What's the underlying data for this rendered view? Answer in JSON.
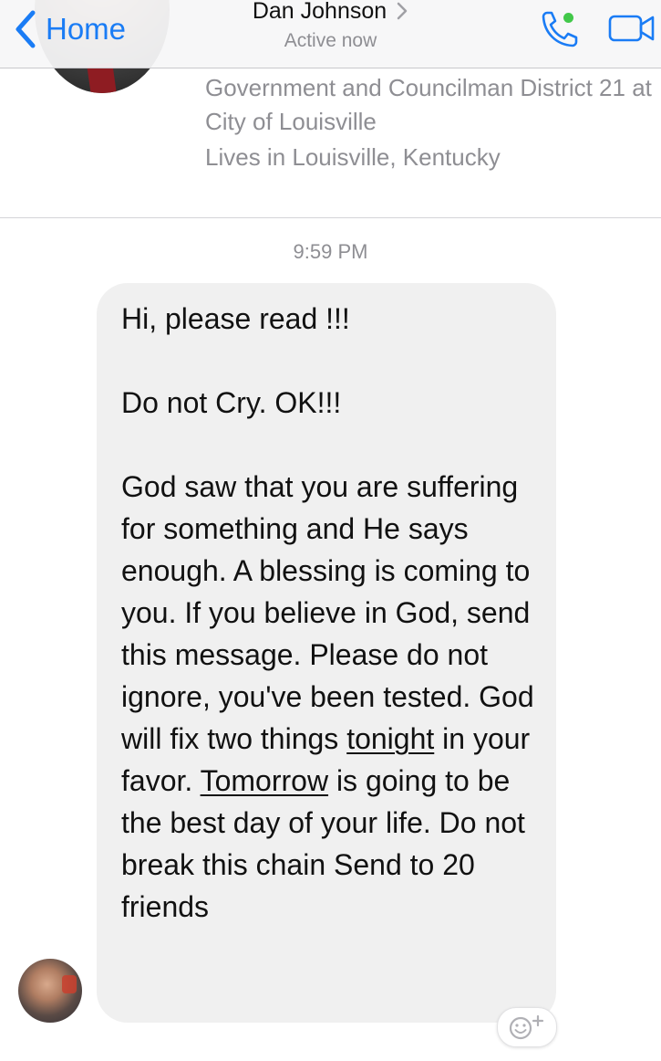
{
  "nav": {
    "back_label": "Home",
    "title": "Dan Johnson",
    "status": "Active now"
  },
  "profile": {
    "work": "Government and Councilman District 21 at City of Louisville",
    "lives": "Lives in Louisville, Kentucky"
  },
  "conversation": {
    "timestamp": "9:59 PM",
    "message": {
      "line1": "Hi, please read !!!",
      "line2": " Do not Cry. OK!!!",
      "p3_before_tonight": " God saw that you are suffering for something and He says enough. A blessing is coming to you. If you believe in God, send this message. Please do not ignore, you've been tested. God will fix two things ",
      "tonight": "tonight",
      "after_tonight": " in your favor. ",
      "tomorrow": "Tomorrow",
      "after_tomorrow": " is going to be the best day of your life. Do not break this chain Send to 20 friends"
    }
  },
  "colors": {
    "accent": "#1a7cf5",
    "active_dot": "#42c84a",
    "bubble_bg": "#f0f0f0",
    "muted_text": "#8e8e93"
  },
  "icons": {
    "back": "chevron-left-icon",
    "title_chevron": "chevron-right-icon",
    "phone": "phone-icon",
    "video": "video-camera-icon",
    "react": "add-reaction-icon"
  }
}
